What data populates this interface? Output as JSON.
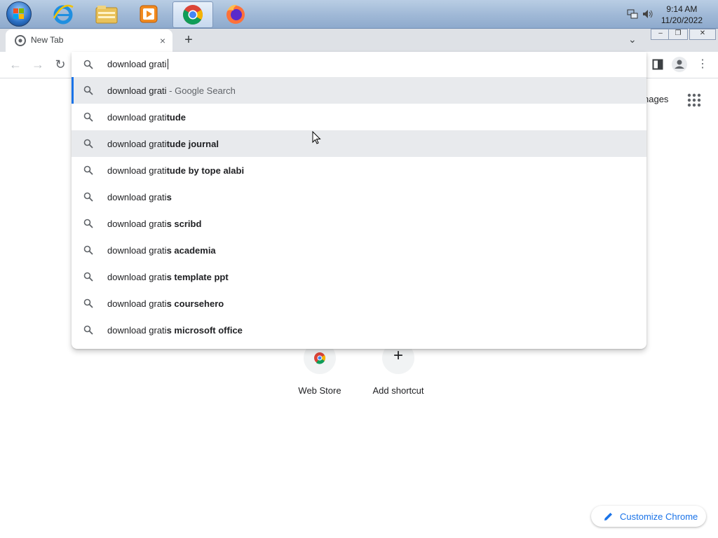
{
  "taskbar": {
    "apps": [
      {
        "name": "internet-explorer-icon"
      },
      {
        "name": "file-explorer-icon"
      },
      {
        "name": "media-player-icon"
      },
      {
        "name": "chrome-icon",
        "active": true
      },
      {
        "name": "firefox-icon"
      }
    ],
    "clock": {
      "time": "9:14 AM",
      "date": "11/20/2022"
    }
  },
  "browser": {
    "tab_title": "New Tab",
    "tab_close": "×",
    "new_tab": "+",
    "window_controls": {
      "minimize": "–",
      "maximize": "❐",
      "close": "✕"
    }
  },
  "omnibox": {
    "input_value": "download grati",
    "suggestions": [
      {
        "typed": "download grati",
        "completion": "",
        "suffix": " - Google Search"
      },
      {
        "typed": "download grati",
        "completion": "tude",
        "suffix": ""
      },
      {
        "typed": "download grati",
        "completion": "tude journal",
        "suffix": ""
      },
      {
        "typed": "download grati",
        "completion": "tude by tope alabi",
        "suffix": ""
      },
      {
        "typed": "download grati",
        "completion": "s",
        "suffix": ""
      },
      {
        "typed": "download grati",
        "completion": "s scribd",
        "suffix": ""
      },
      {
        "typed": "download grati",
        "completion": "s academia",
        "suffix": ""
      },
      {
        "typed": "download grati",
        "completion": "s template ppt",
        "suffix": ""
      },
      {
        "typed": "download grati",
        "completion": "s coursehero",
        "suffix": ""
      },
      {
        "typed": "download grati",
        "completion": "s microsoft office",
        "suffix": ""
      }
    ]
  },
  "ntp": {
    "images_link": "nages",
    "shortcuts": [
      {
        "label": "Web Store"
      },
      {
        "label": "Add shortcut",
        "icon": "+"
      }
    ],
    "customize_label": "Customize Chrome"
  },
  "colors": {
    "accent": "#1a73e8",
    "highlight": "#e8eaed"
  }
}
